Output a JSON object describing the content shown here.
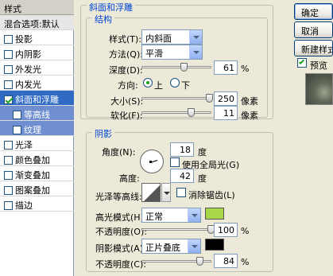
{
  "sidebar": {
    "header": "样式",
    "blend_options": "混合选项:默认",
    "items": [
      {
        "label": "投影",
        "checked": false
      },
      {
        "label": "内阴影",
        "checked": false
      },
      {
        "label": "外发光",
        "checked": false
      },
      {
        "label": "内发光",
        "checked": false
      },
      {
        "label": "斜面和浮雕",
        "checked": true
      },
      {
        "label": "等高线",
        "checked": false
      },
      {
        "label": "纹理",
        "checked": false
      },
      {
        "label": "光泽",
        "checked": false
      },
      {
        "label": "颜色叠加",
        "checked": false
      },
      {
        "label": "渐变叠加",
        "checked": false
      },
      {
        "label": "图案叠加",
        "checked": false
      },
      {
        "label": "描边",
        "checked": false
      }
    ]
  },
  "bevel": {
    "panel_title": "斜面和浮雕",
    "structure_title": "结构",
    "style_label": "样式(T):",
    "style_value": "内斜面",
    "method_label": "方法(Q):",
    "method_value": "平滑",
    "depth_label": "深度(D):",
    "depth_value": "61",
    "depth_unit": "%",
    "direction_label": "方向:",
    "dir_up": "上",
    "dir_down": "下",
    "size_label": "大小(S):",
    "size_value": "250",
    "size_unit": "像素",
    "soften_label": "软化(F):",
    "soften_value": "11",
    "soften_unit": "像素"
  },
  "shading": {
    "title": "阴影",
    "angle_label": "角度(N):",
    "angle_value": "18",
    "angle_unit": "度",
    "global_light_label": "使用全局光(G)",
    "altitude_label": "高度:",
    "altitude_value": "42",
    "altitude_unit": "度",
    "gloss_label": "光泽等高线:",
    "antialias_label": "消除锯齿(L)",
    "highlight_label": "高光模式(H):",
    "highlight_mode": "正常",
    "highlight_color": "#a8d84a",
    "hl_opacity_label": "不透明度(O):",
    "hl_opacity_value": "100",
    "hl_opacity_unit": "%",
    "shadow_label": "阴影模式(A):",
    "shadow_mode": "正片叠底",
    "shadow_color": "#000000",
    "sh_opacity_label": "不透明度(C):",
    "sh_opacity_value": "84",
    "sh_opacity_unit": "%"
  },
  "levels": {
    "depth": 0.61,
    "size": 0.98,
    "soften": 0.72,
    "hl_opacity": 1.0,
    "sh_opacity": 0.84
  },
  "actions": {
    "ok": "确定",
    "cancel": "取消",
    "new_style": "新建样式",
    "preview": "预览"
  }
}
